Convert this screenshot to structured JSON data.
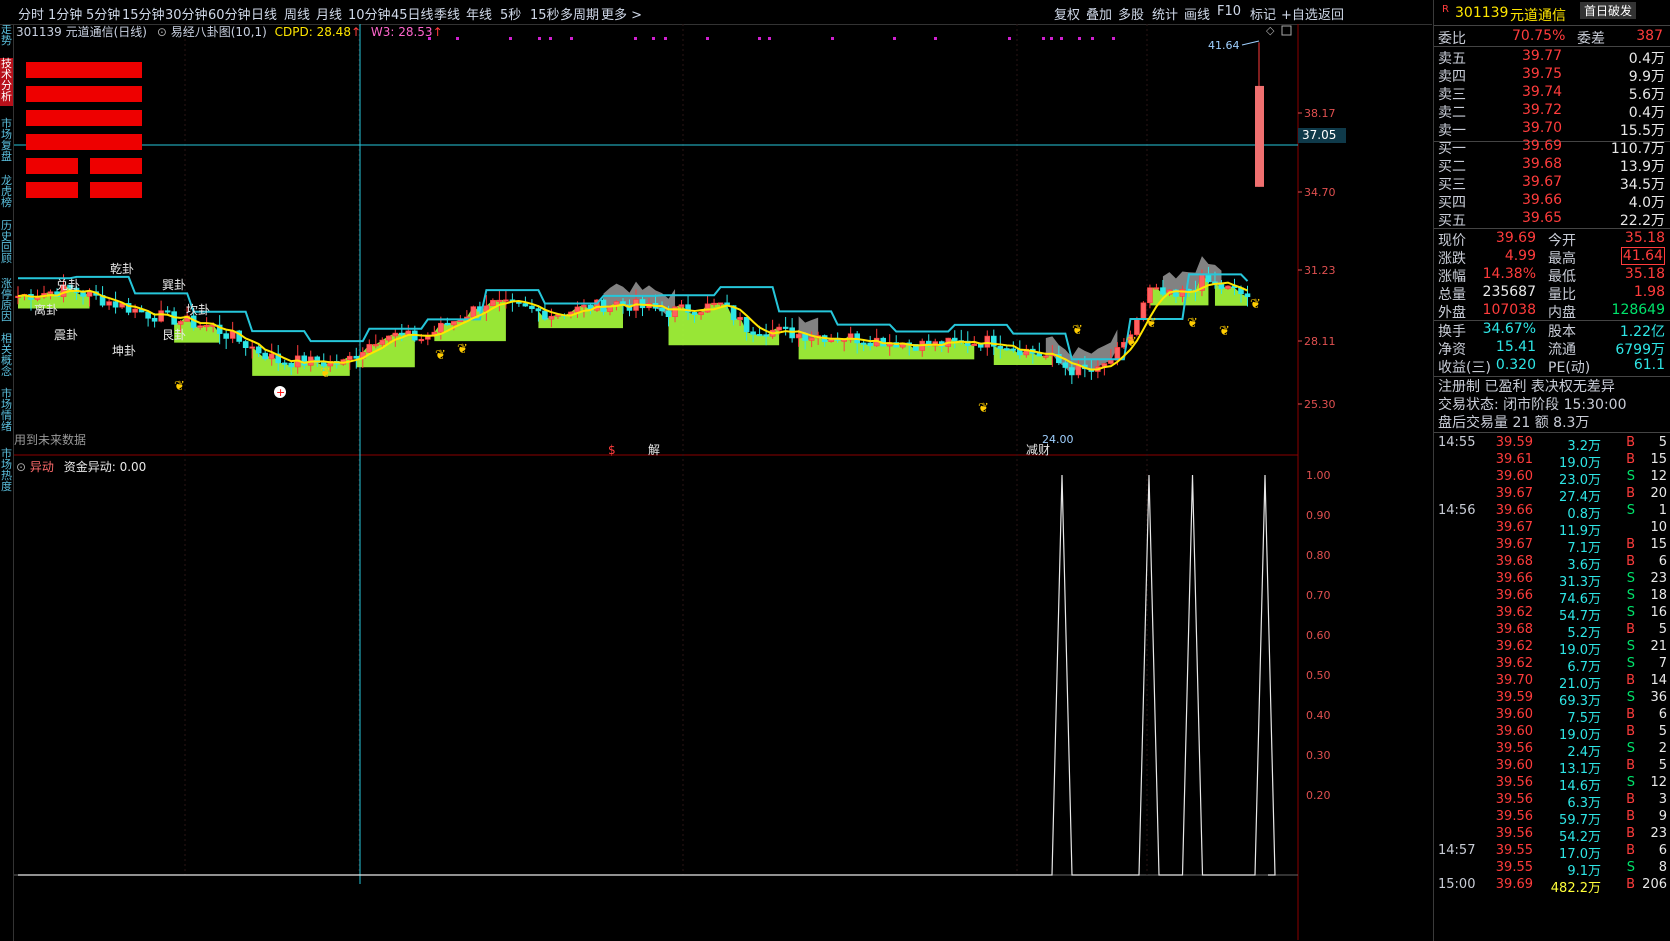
{
  "toolbar": {
    "periods": [
      "分时",
      "1分钟",
      "5分钟",
      "15分钟",
      "30分钟",
      "60分钟",
      "日线",
      "周线",
      "月线",
      "10分钟",
      "45日线",
      "季线",
      "年线",
      "5秒",
      "15秒",
      "多周期",
      "更多 >"
    ],
    "actions": [
      "复权",
      "叠加",
      "多股",
      "统计",
      "画线",
      "F10",
      "标记",
      "+自选",
      "返回"
    ]
  },
  "left_tabs": [
    "分时走势",
    "技术分析",
    "市场复盘",
    "龙虎榜",
    "历史回顾",
    "涨停原因",
    "相关概念",
    "市场情绪",
    "市场热度"
  ],
  "chart": {
    "header_title": "301139 元道通信(日线)",
    "indicator_name": "易经八卦图(10,1)",
    "cdpd_label": "CDPD: 28.48",
    "w3_label": "W3: 28.53",
    "future_data_note": "用到未来数据",
    "price_levels": [
      "38.17",
      "34.70",
      "31.23",
      "28.11",
      "25.30"
    ],
    "crosshair_price": "37.05",
    "high_marker": "41.64",
    "low_marker": "24.00",
    "gua_labels": [
      "乾卦",
      "巽卦",
      "坎卦",
      "兑卦",
      "离卦",
      "震卦",
      "艮卦",
      "坤卦"
    ],
    "bottom_markers": [
      "$",
      "解",
      "减财"
    ],
    "colors": {
      "up": "#ff3c3c",
      "down": "#2ee6e6",
      "fill": "#a8ff3c",
      "ma": "#ffe600",
      "line": "#26c6da",
      "bg": "#000000"
    }
  },
  "sub_chart": {
    "title": "异动",
    "indicator_label": "资金异动: 0.00",
    "y_ticks": [
      "1.00",
      "0.90",
      "0.80",
      "0.70",
      "0.60",
      "0.50",
      "0.40",
      "0.30",
      "0.20"
    ],
    "signals": [
      {
        "t": 0.72,
        "v": 1.0
      },
      {
        "t": 0.78,
        "v": 1.0
      },
      {
        "t": 0.81,
        "v": 1.0
      },
      {
        "t": 0.86,
        "v": 1.0
      }
    ]
  },
  "quote": {
    "code": "301139",
    "name": "元道通信",
    "badge": "首日破发",
    "wei_bi_label": "委比",
    "wei_bi": "70.75%",
    "wei_cha_label": "委差",
    "wei_cha": "387",
    "asks": [
      {
        "label": "卖五",
        "price": "39.77",
        "vol": "0.4万"
      },
      {
        "label": "卖四",
        "price": "39.75",
        "vol": "9.9万"
      },
      {
        "label": "卖三",
        "price": "39.74",
        "vol": "5.6万"
      },
      {
        "label": "卖二",
        "price": "39.72",
        "vol": "0.4万"
      },
      {
        "label": "卖一",
        "price": "39.70",
        "vol": "15.5万"
      }
    ],
    "bids": [
      {
        "label": "买一",
        "price": "39.69",
        "vol": "110.7万"
      },
      {
        "label": "买二",
        "price": "39.68",
        "vol": "13.9万"
      },
      {
        "label": "买三",
        "price": "39.67",
        "vol": "34.5万"
      },
      {
        "label": "买四",
        "price": "39.66",
        "vol": "4.0万"
      },
      {
        "label": "买五",
        "price": "39.65",
        "vol": "22.2万"
      }
    ],
    "stats": [
      {
        "l1": "现价",
        "v1": "39.69",
        "c1": "red",
        "l2": "今开",
        "v2": "35.18",
        "c2": "red"
      },
      {
        "l1": "涨跌",
        "v1": "4.99",
        "c1": "red",
        "l2": "最高",
        "v2": "41.64",
        "c2": "red"
      },
      {
        "l1": "涨幅",
        "v1": "14.38%",
        "c1": "red",
        "l2": "最低",
        "v2": "35.18",
        "c2": "red"
      },
      {
        "l1": "总量",
        "v1": "235687",
        "c1": "white",
        "l2": "量比",
        "v2": "1.98",
        "c2": "red"
      },
      {
        "l1": "外盘",
        "v1": "107038",
        "c1": "red",
        "l2": "内盘",
        "v2": "128649",
        "c2": "green"
      }
    ],
    "stats2": [
      {
        "l1": "换手",
        "v1": "34.67%",
        "l2": "股本",
        "v2": "1.22亿"
      },
      {
        "l1": "净资",
        "v1": "15.41",
        "l2": "流通",
        "v2": "6799万"
      },
      {
        "l1": "收益(三)",
        "v1": "0.320",
        "l2": "PE(动)",
        "v2": "61.1"
      }
    ],
    "info_lines": [
      "注册制 已盈利 表决权无差异",
      "交易状态: 闭市阶段 15:30:00",
      "盘后交易量 21 额 8.3万"
    ]
  },
  "ticks": [
    {
      "time": "14:55",
      "price": "39.59",
      "vol": "3.2万",
      "bs": "B",
      "n": "5"
    },
    {
      "time": "",
      "price": "39.61",
      "vol": "19.0万",
      "bs": "B",
      "n": "15"
    },
    {
      "time": "",
      "price": "39.60",
      "vol": "23.0万",
      "bs": "S",
      "n": "12"
    },
    {
      "time": "",
      "price": "39.67",
      "vol": "27.4万",
      "bs": "B",
      "n": "20"
    },
    {
      "time": "14:56",
      "price": "39.66",
      "vol": "0.8万",
      "bs": "S",
      "n": "1"
    },
    {
      "time": "",
      "price": "39.67",
      "vol": "11.9万",
      "bs": "",
      "n": "10"
    },
    {
      "time": "",
      "price": "39.67",
      "vol": "7.1万",
      "bs": "B",
      "n": "15"
    },
    {
      "time": "",
      "price": "39.68",
      "vol": "3.6万",
      "bs": "B",
      "n": "6"
    },
    {
      "time": "",
      "price": "39.66",
      "vol": "31.3万",
      "bs": "S",
      "n": "23"
    },
    {
      "time": "",
      "price": "39.66",
      "vol": "74.6万",
      "bs": "S",
      "n": "18"
    },
    {
      "time": "",
      "price": "39.62",
      "vol": "54.7万",
      "bs": "S",
      "n": "16"
    },
    {
      "time": "",
      "price": "39.68",
      "vol": "5.2万",
      "bs": "B",
      "n": "5"
    },
    {
      "time": "",
      "price": "39.62",
      "vol": "19.0万",
      "bs": "S",
      "n": "21"
    },
    {
      "time": "",
      "price": "39.62",
      "vol": "6.7万",
      "bs": "S",
      "n": "7"
    },
    {
      "time": "",
      "price": "39.70",
      "vol": "21.0万",
      "bs": "B",
      "n": "14"
    },
    {
      "time": "",
      "price": "39.59",
      "vol": "69.3万",
      "bs": "S",
      "n": "36"
    },
    {
      "time": "",
      "price": "39.60",
      "vol": "7.5万",
      "bs": "B",
      "n": "6"
    },
    {
      "time": "",
      "price": "39.60",
      "vol": "19.0万",
      "bs": "B",
      "n": "5"
    },
    {
      "time": "",
      "price": "39.56",
      "vol": "2.4万",
      "bs": "S",
      "n": "2"
    },
    {
      "time": "",
      "price": "39.60",
      "vol": "13.1万",
      "bs": "B",
      "n": "5"
    },
    {
      "time": "",
      "price": "39.56",
      "vol": "14.6万",
      "bs": "S",
      "n": "12"
    },
    {
      "time": "",
      "price": "39.56",
      "vol": "6.3万",
      "bs": "B",
      "n": "3"
    },
    {
      "time": "",
      "price": "39.56",
      "vol": "59.7万",
      "bs": "B",
      "n": "9"
    },
    {
      "time": "",
      "price": "39.56",
      "vol": "54.2万",
      "bs": "B",
      "n": "23"
    },
    {
      "time": "14:57",
      "price": "39.55",
      "vol": "17.0万",
      "bs": "B",
      "n": "6"
    },
    {
      "time": "",
      "price": "39.55",
      "vol": "9.1万",
      "bs": "S",
      "n": "8"
    },
    {
      "time": "15:00",
      "price": "39.69",
      "vol": "482.2万",
      "bs": "B",
      "n": "206"
    }
  ]
}
